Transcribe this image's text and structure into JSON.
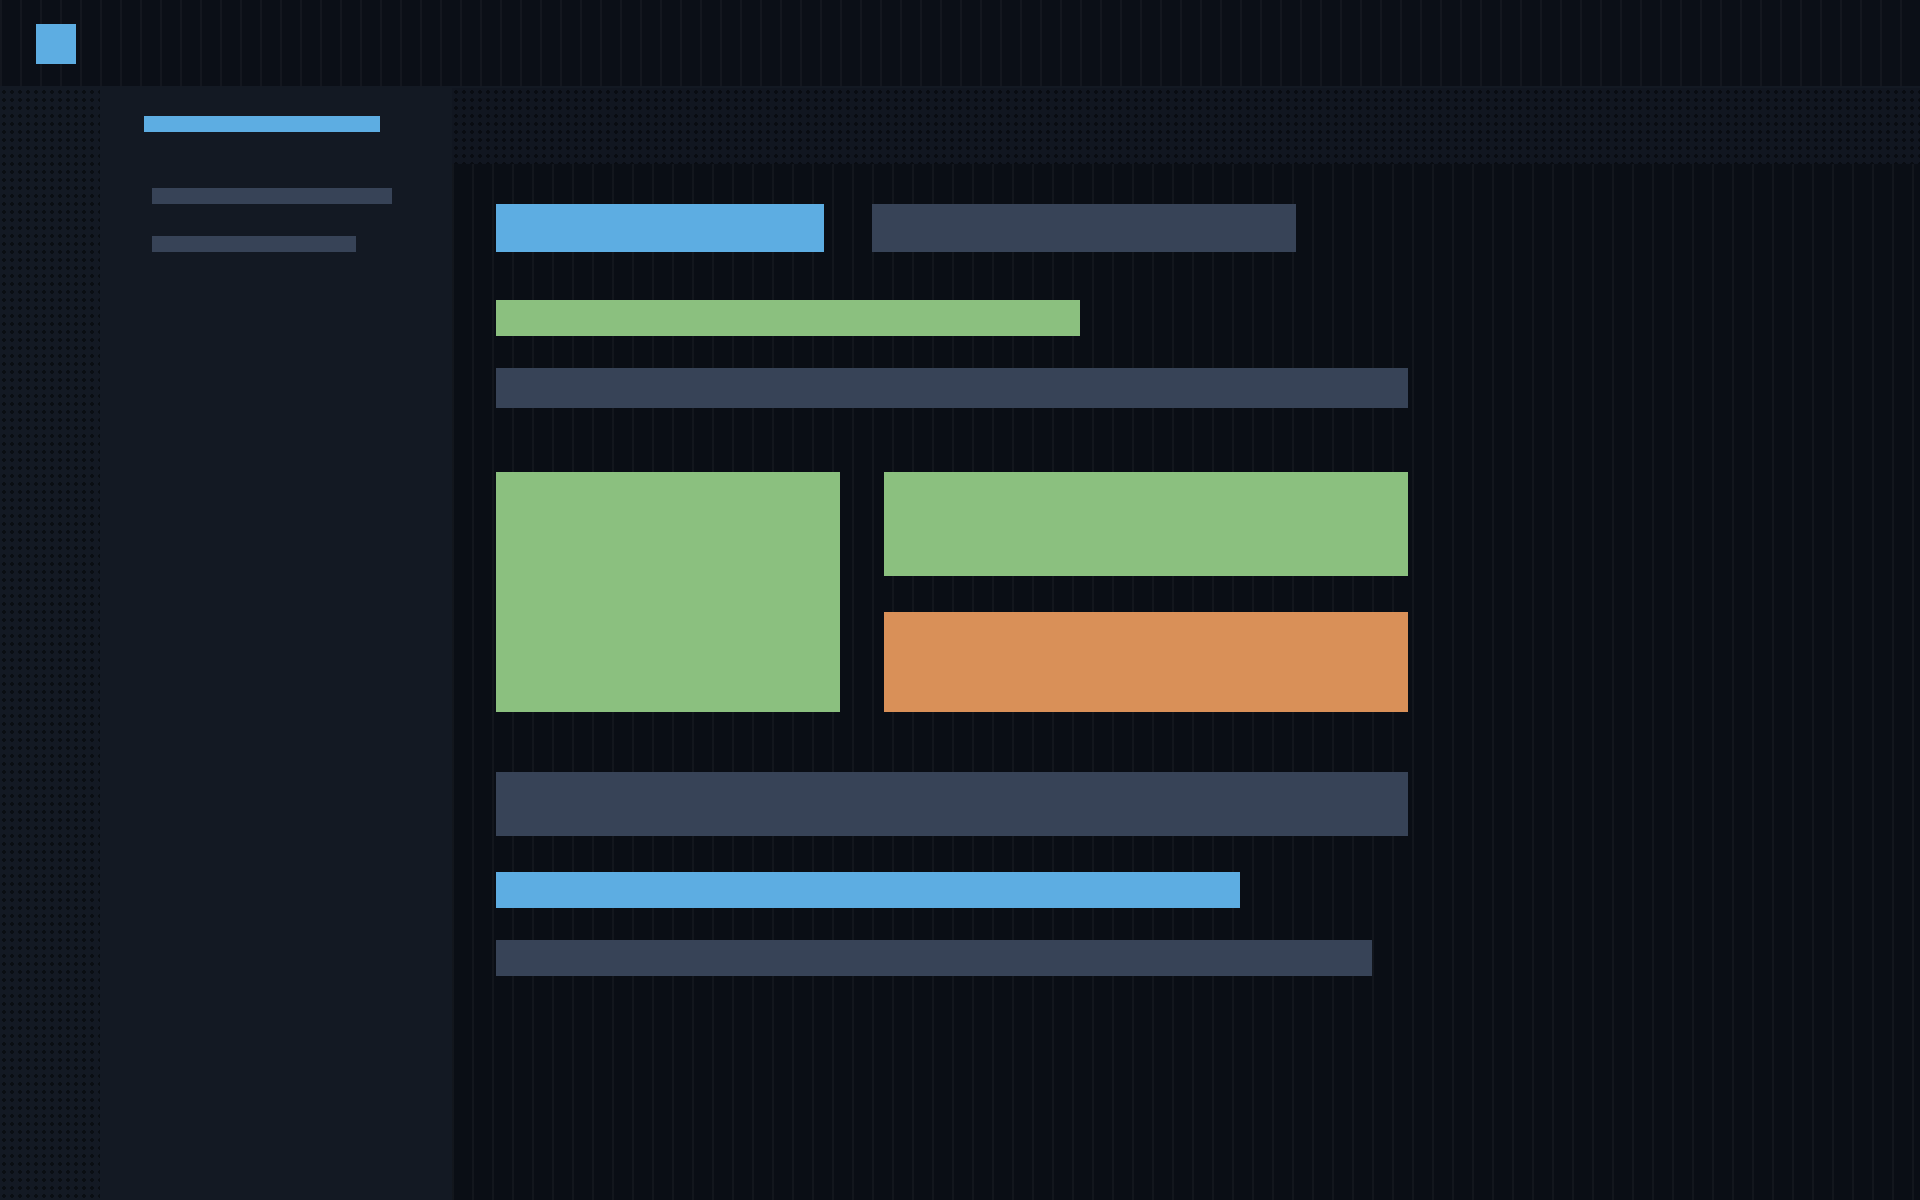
{
  "header": {
    "logo": {
      "color": "#5dade2"
    }
  },
  "sidebar": {
    "items": [
      {
        "selected": true
      },
      {
        "selected": false
      },
      {
        "selected": false
      }
    ]
  },
  "content": {
    "rows": [
      {
        "blocks": [
          {
            "kind": "bar",
            "color": "#5dade2"
          },
          {
            "kind": "bar",
            "color": "#374357"
          }
        ]
      },
      {
        "blocks": [
          {
            "kind": "bar",
            "color": "#8bc07f"
          }
        ]
      },
      {
        "blocks": [
          {
            "kind": "bar",
            "color": "#374357"
          }
        ]
      },
      {
        "blocks": [
          {
            "kind": "tile",
            "color": "#8bc07f"
          },
          {
            "kind": "stack",
            "children": [
              {
                "kind": "tile",
                "color": "#8bc07f"
              },
              {
                "kind": "tile",
                "color": "#d99058"
              }
            ]
          }
        ]
      },
      {
        "blocks": [
          {
            "kind": "bar",
            "color": "#374357"
          }
        ]
      },
      {
        "blocks": [
          {
            "kind": "bar",
            "color": "#5dade2"
          }
        ]
      },
      {
        "blocks": [
          {
            "kind": "bar",
            "color": "#374357"
          }
        ]
      }
    ]
  }
}
